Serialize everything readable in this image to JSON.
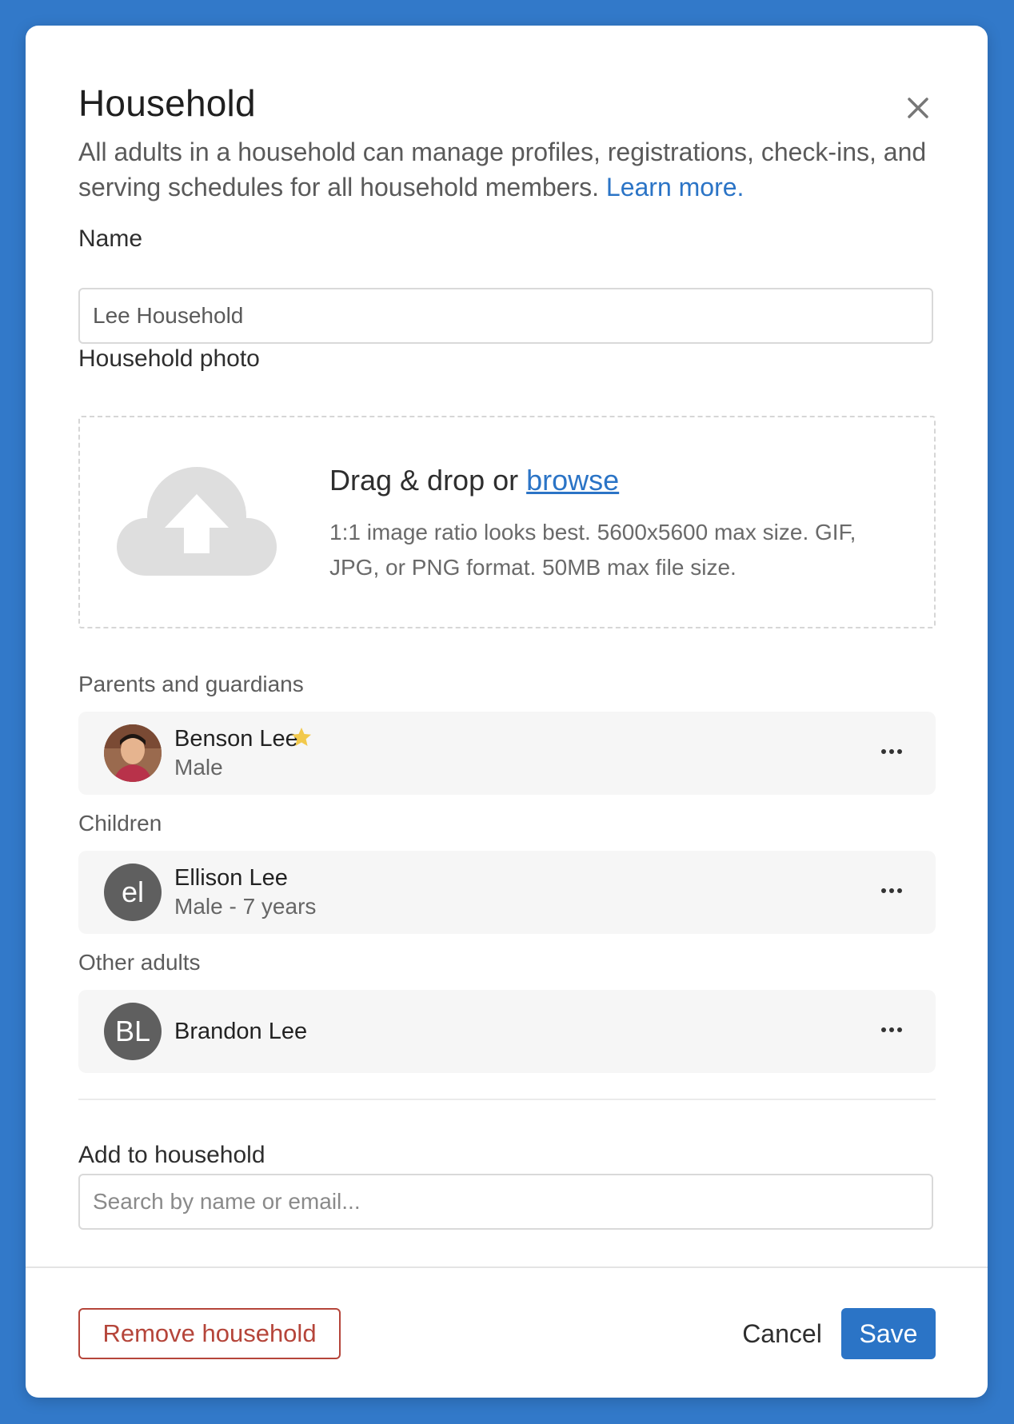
{
  "modal": {
    "title": "Household",
    "description": "All adults in a household can manage profiles, registrations, check-ins, and serving schedules for all household members.",
    "learn_more": "Learn more."
  },
  "name_field": {
    "label": "Name",
    "value": "Lee Household"
  },
  "photo": {
    "label": "Household photo",
    "drag_text": "Drag & drop or",
    "browse_text": "browse",
    "help_text": "1:1 image ratio looks best. 5600x5600 max size. GIF, JPG, or PNG format. 50MB max file size."
  },
  "sections": {
    "parents": {
      "label": "Parents and guardians",
      "members": [
        {
          "name": "Benson Lee",
          "sub": "Male",
          "initials": "",
          "primary": true,
          "has_photo": true
        }
      ]
    },
    "children": {
      "label": "Children",
      "members": [
        {
          "name": "Ellison Lee",
          "sub": "Male - 7 years",
          "initials": "el",
          "primary": false,
          "has_photo": false
        }
      ]
    },
    "other_adults": {
      "label": "Other adults",
      "members": [
        {
          "name": "Brandon Lee",
          "sub": "",
          "initials": "BL",
          "primary": false,
          "has_photo": false
        }
      ]
    }
  },
  "add_to_household": {
    "label": "Add to household",
    "placeholder": "Search by name or email..."
  },
  "footer": {
    "remove_label": "Remove household",
    "cancel_label": "Cancel",
    "save_label": "Save"
  },
  "colors": {
    "background": "#3279c9",
    "accent": "#2b74c6",
    "danger": "#b5453a",
    "star": "#f2c94c"
  }
}
